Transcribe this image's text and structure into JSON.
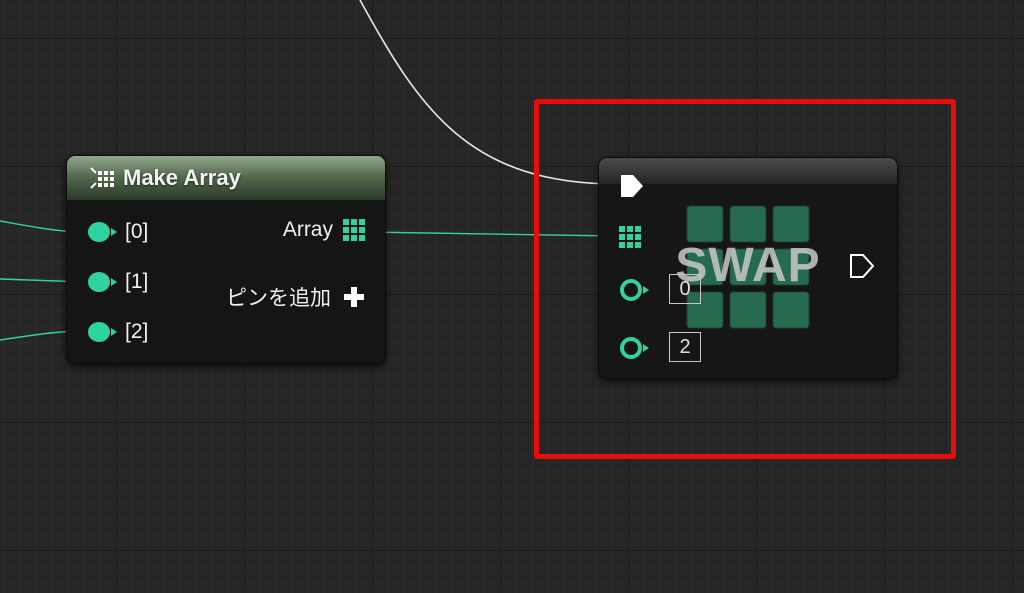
{
  "make_array": {
    "title": "Make Array",
    "inputs": [
      "[0]",
      "[1]",
      "[2]"
    ],
    "output_label": "Array",
    "add_pin_label": "ピンを追加"
  },
  "swap": {
    "title": "SWAP",
    "first_index": "0",
    "second_index": "2"
  },
  "colors": {
    "pin_accent": "#2fd3a0",
    "highlight": "#e90c0c",
    "header_green": "#556b4f"
  },
  "icons": [
    "array-icon",
    "plus-icon",
    "exec-pin-icon",
    "integer-pin-icon"
  ]
}
